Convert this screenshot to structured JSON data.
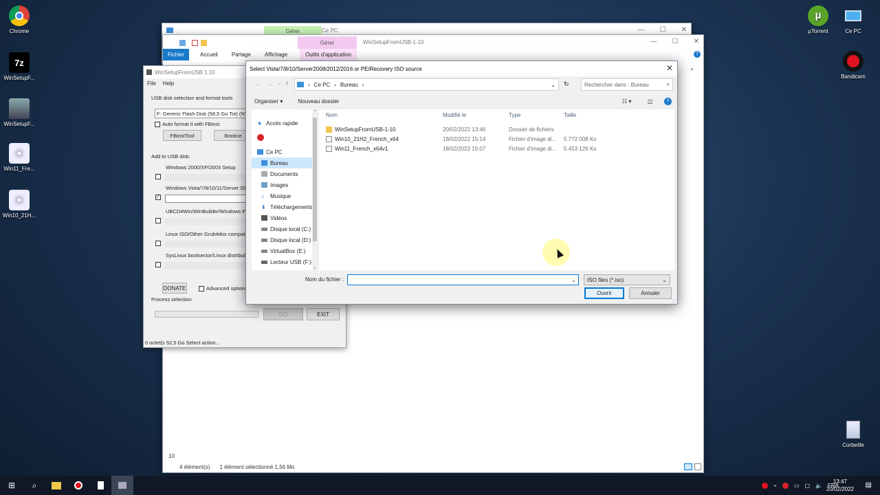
{
  "desktop": {
    "icons_left": [
      {
        "label": "Chrome",
        "icon": "chrome-icon"
      },
      {
        "label": "WinSetupF...",
        "icon": "7zip-icon",
        "glyph": "7z"
      },
      {
        "label": "WinSetupF...",
        "icon": "usb-tool-icon"
      },
      {
        "label": "Win11_Fre...",
        "icon": "disc-icon"
      },
      {
        "label": "Win10_21H...",
        "icon": "disc-icon"
      }
    ],
    "icons_right": [
      {
        "label": "µTorrent",
        "icon": "utorrent-icon"
      },
      {
        "label": "Ce PC",
        "icon": "computer-icon"
      },
      {
        "label": "Bandicam",
        "icon": "bandicam-icon"
      },
      {
        "label": "Corbeille",
        "icon": "recycle-bin-icon"
      }
    ]
  },
  "explorer_back": {
    "ribbon_tab_manage": "Gérer",
    "title": "Ce PC"
  },
  "explorer_front": {
    "title": "WinSetupFromUSB-1-10",
    "ribbon_tab_manage": "Gérer",
    "tabs": [
      "Fichier",
      "Accueil",
      "Partage",
      "Affichage",
      "Outils d'application"
    ],
    "status_count": "4 élément(s)",
    "status_selected": "1 élément sélectionné  1,56 Mo",
    "partial_left": "10"
  },
  "wsfu": {
    "title": "WinSetupFromUSB 1.10",
    "menu": [
      "File",
      "Help"
    ],
    "disk_label": "USB disk selection and format tools",
    "disk_value": "F: Generic Flash Disk (58,5 Go Tot) (NTF",
    "autoformat": "Auto format it with FBinst",
    "fbinst_btn": "FBinstTool",
    "bootice_btn": "Bootice",
    "add_label": "Add to USB disk:",
    "options": [
      {
        "label": "Windows 2000/XP/2003 Setup",
        "checked": false
      },
      {
        "label": "Windows Vista/7/8/10/11/Server 20",
        "checked": true
      },
      {
        "label": "UBCD4Win/WinBuilder/Windows FL",
        "checked": false
      },
      {
        "label": "Linux ISO/Other Grub4dos compatib",
        "checked": false
      },
      {
        "label": "SysLinux bootsector/Linux distribution",
        "checked": false
      }
    ],
    "donate_btn": "DONATE",
    "advanced": "Advanced options",
    "process_label": "Process selection",
    "go_btn": "GO",
    "exit_btn": "EXIT",
    "status": "0 octet(s 52,5 Go  Select action..."
  },
  "dialog": {
    "title": "Select Vista/7/8/10/Server2008/2012/2016 or PE/Recovery ISO source",
    "path": [
      "Ce PC",
      "Bureau"
    ],
    "search_placeholder": "Rechercher dans : Bureau",
    "organize": "Organiser",
    "new_folder": "Nouveau dossier",
    "nav_items": [
      {
        "label": "Accès rapide",
        "icon": "star-icon",
        "color": "#2a7ad5"
      },
      {
        "label": "",
        "icon": "red-app-icon",
        "color": "#d8232a"
      },
      {
        "label": "Ce PC",
        "icon": "computer-icon",
        "color": "#3b8fd9"
      },
      {
        "label": "Bureau",
        "icon": "desktop-folder-icon",
        "color": "#3b8fd9",
        "selected": true
      },
      {
        "label": "Documents",
        "icon": "documents-icon",
        "color": "#8a8a8a"
      },
      {
        "label": "Images",
        "icon": "images-icon",
        "color": "#6fa0c8"
      },
      {
        "label": "Musique",
        "icon": "music-icon",
        "color": "#2a7ad5"
      },
      {
        "label": "Téléchargements",
        "icon": "download-icon",
        "color": "#2a7ad5"
      },
      {
        "label": "Vidéos",
        "icon": "videos-icon",
        "color": "#555"
      },
      {
        "label": "Disque local (C:)",
        "icon": "drive-icon",
        "color": "#666"
      },
      {
        "label": "Disque local (D:)",
        "icon": "drive-icon",
        "color": "#666"
      },
      {
        "label": "VirtualBox (E:)",
        "icon": "drive-icon",
        "color": "#666"
      },
      {
        "label": "Lecteur USB (F:)",
        "icon": "usb-drive-icon",
        "color": "#666"
      }
    ],
    "columns": [
      "Nom",
      "Modifié le",
      "Type",
      "Taille"
    ],
    "files": [
      {
        "name": "WinSetupFromUSB-1-10",
        "modified": "20/02/2022 13:46",
        "type": "Dossier de fichiers",
        "size": "",
        "icon": "folder-icon"
      },
      {
        "name": "Win10_21H2_French_x64",
        "modified": "18/02/2022 15:14",
        "type": "Fichier d'image di...",
        "size": "5 772 008 Ko",
        "icon": "iso-file-icon"
      },
      {
        "name": "Win11_French_x64v1",
        "modified": "18/02/2022 15:07",
        "type": "Fichier d'image di...",
        "size": "5 453 126 Ko",
        "icon": "iso-file-icon"
      }
    ],
    "filename_label": "Nom du fichier :",
    "filename_value": "",
    "filetype": "ISO files (*.iso)",
    "open_btn": "Ouvrir",
    "cancel_btn": "Annuler"
  },
  "taskbar": {
    "lang": "FRA",
    "time": "13:47",
    "date": "20/02/2022"
  }
}
